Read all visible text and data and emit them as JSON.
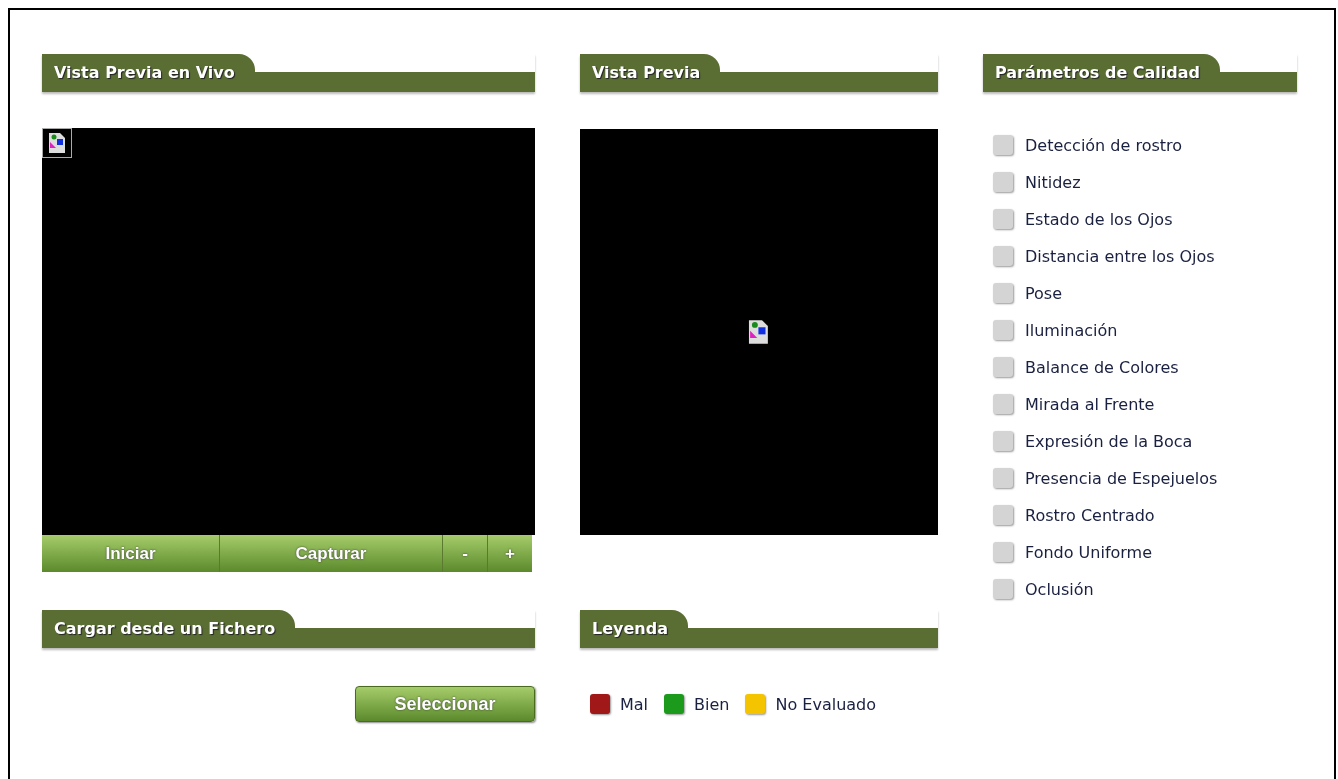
{
  "live_preview": {
    "title": "Vista Previa en Vivo",
    "buttons": [
      "Iniciar",
      "Capturar",
      "-",
      "+"
    ]
  },
  "preview": {
    "title": "Vista Previa"
  },
  "load_file": {
    "title": "Cargar desde un Fichero",
    "button": "Seleccionar"
  },
  "legend": {
    "title": "Leyenda",
    "items": [
      {
        "label": "Mal",
        "color": "#a01818"
      },
      {
        "label": "Bien",
        "color": "#1c9a1c"
      },
      {
        "label": "No Evaluado",
        "color": "#f5c400"
      }
    ]
  },
  "quality": {
    "title": "Parámetros de Calidad",
    "items": [
      {
        "label": "Detección de rostro",
        "color": "#d4d4d4"
      },
      {
        "label": "Nitidez",
        "color": "#d4d4d4"
      },
      {
        "label": "Estado de los Ojos",
        "color": "#d4d4d4"
      },
      {
        "label": "Distancia entre los Ojos",
        "color": "#d4d4d4"
      },
      {
        "label": "Pose",
        "color": "#d4d4d4"
      },
      {
        "label": "Iluminación",
        "color": "#d4d4d4"
      },
      {
        "label": "Balance de Colores",
        "color": "#d4d4d4"
      },
      {
        "label": "Mirada al Frente",
        "color": "#d4d4d4"
      },
      {
        "label": "Expresión de la Boca",
        "color": "#d4d4d4"
      },
      {
        "label": "Presencia de Espejuelos",
        "color": "#d4d4d4"
      },
      {
        "label": "Rostro Centrado",
        "color": "#d4d4d4"
      },
      {
        "label": "Fondo Uniforme",
        "color": "#d4d4d4"
      },
      {
        "label": "Oclusión",
        "color": "#d4d4d4"
      }
    ]
  }
}
